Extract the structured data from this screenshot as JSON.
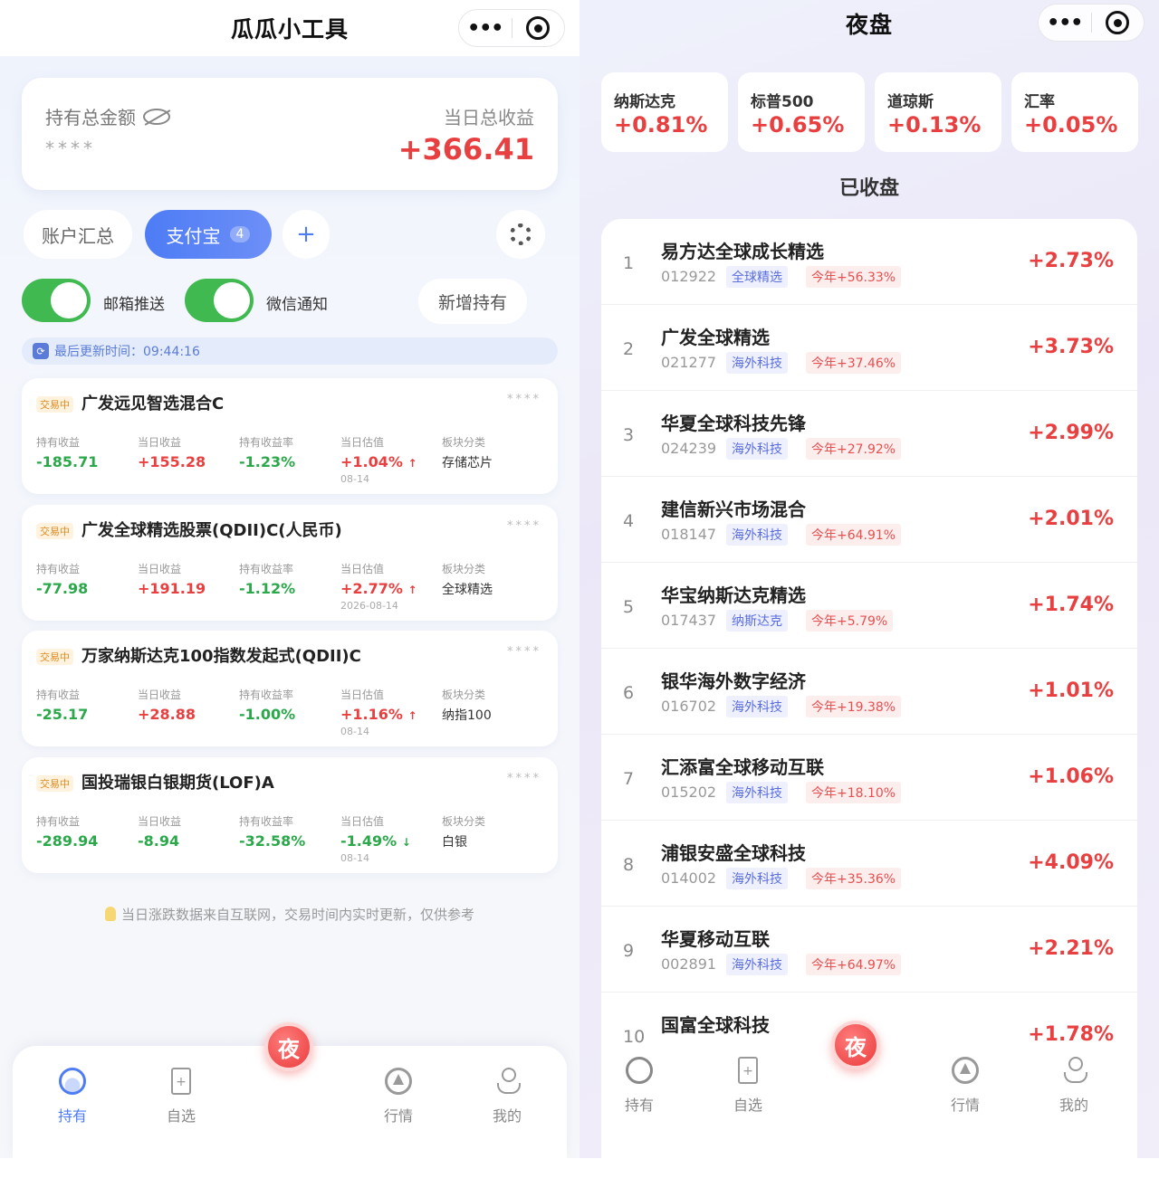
{
  "left": {
    "title": "瓜瓜小工具",
    "summary": {
      "total_label": "持有总金额",
      "total_masked": "****",
      "daily_label": "当日总收益",
      "daily_value": "+366.41"
    },
    "tabs": {
      "account": "账户汇总",
      "alipay": "支付宝",
      "alipay_count": "4",
      "add": "+"
    },
    "toggles": {
      "email": "邮箱推送",
      "wechat": "微信通知",
      "email_on": true,
      "wechat_on": true
    },
    "new_holding": "新增持有",
    "update_label": "最后更新时间：09:44:16",
    "col_labels": {
      "hold_profit": "持有收益",
      "day_profit": "当日收益",
      "hold_rate": "持有收益率",
      "day_est": "当日估值",
      "sector": "板块分类"
    },
    "funds": [
      {
        "status": "交易中",
        "name": "广发远见智选混合C",
        "masked": "****",
        "hold_profit": "-185.71",
        "day_profit": "+155.28",
        "hold_rate": "-1.23%",
        "day_est": "+1.04%",
        "arrow": "↑",
        "date": "08-14",
        "sector": "存储芯片"
      },
      {
        "status": "交易中",
        "name": "广发全球精选股票(QDII)C(人民币)",
        "masked": "****",
        "hold_profit": "-77.98",
        "day_profit": "+191.19",
        "hold_rate": "-1.12%",
        "day_est": "+2.77%",
        "arrow": "↑",
        "date": "2026-08-14",
        "sector": "全球精选"
      },
      {
        "status": "交易中",
        "name": "万家纳斯达克100指数发起式(QDII)C",
        "masked": "****",
        "hold_profit": "-25.17",
        "day_profit": "+28.88",
        "hold_rate": "-1.00%",
        "day_est": "+1.16%",
        "arrow": "↑",
        "date": "08-14",
        "sector": "纳指100"
      },
      {
        "status": "交易中",
        "name": "国投瑞银白银期货(LOF)A",
        "masked": "****",
        "hold_profit": "-289.94",
        "day_profit": "-8.94",
        "hold_rate": "-32.58%",
        "day_est": "-1.49%",
        "arrow": "↓",
        "date": "08-14",
        "sector": "白银"
      }
    ],
    "notice": "当日涨跌数据来自互联网，交易时间内实时更新，仅供参考",
    "nav": {
      "hold": "持有",
      "watch": "自选",
      "night": "夜",
      "market": "行情",
      "me": "我的"
    }
  },
  "right": {
    "title": "夜盘",
    "indices": [
      {
        "name": "纳斯达克",
        "pct": "+0.81%"
      },
      {
        "name": "标普500",
        "pct": "+0.65%"
      },
      {
        "name": "道琼斯",
        "pct": "+0.13%"
      },
      {
        "name": "汇率",
        "pct": "+0.05%"
      }
    ],
    "status": "已收盘",
    "funds": [
      {
        "rank": "1",
        "name": "易方达全球成长精选",
        "code": "012922",
        "tag": "全球精选",
        "ytd": "今年+56.33%",
        "pct": "+2.73%"
      },
      {
        "rank": "2",
        "name": "广发全球精选",
        "code": "021277",
        "tag": "海外科技",
        "ytd": "今年+37.46%",
        "pct": "+3.73%"
      },
      {
        "rank": "3",
        "name": "华夏全球科技先锋",
        "code": "024239",
        "tag": "海外科技",
        "ytd": "今年+27.92%",
        "pct": "+2.99%"
      },
      {
        "rank": "4",
        "name": "建信新兴市场混合",
        "code": "018147",
        "tag": "海外科技",
        "ytd": "今年+64.91%",
        "pct": "+2.01%"
      },
      {
        "rank": "5",
        "name": "华宝纳斯达克精选",
        "code": "017437",
        "tag": "纳斯达克",
        "ytd": "今年+5.79%",
        "pct": "+1.74%"
      },
      {
        "rank": "6",
        "name": "银华海外数字经济",
        "code": "016702",
        "tag": "海外科技",
        "ytd": "今年+19.38%",
        "pct": "+1.01%"
      },
      {
        "rank": "7",
        "name": "汇添富全球移动互联",
        "code": "015202",
        "tag": "海外科技",
        "ytd": "今年+18.10%",
        "pct": "+1.06%"
      },
      {
        "rank": "8",
        "name": "浦银安盛全球科技",
        "code": "014002",
        "tag": "海外科技",
        "ytd": "今年+35.36%",
        "pct": "+4.09%"
      },
      {
        "rank": "9",
        "name": "华夏移动互联",
        "code": "002891",
        "tag": "海外科技",
        "ytd": "今年+64.97%",
        "pct": "+2.21%"
      },
      {
        "rank": "10",
        "name": "国富全球科技",
        "code": "",
        "tag": "",
        "ytd": "",
        "pct": "+1.78%"
      }
    ],
    "nav": {
      "hold": "持有",
      "watch": "自选",
      "night": "夜",
      "market": "行情",
      "me": "我的"
    }
  },
  "colors": {
    "up": "#e84040",
    "down": "#2aa84a",
    "accent": "#4d7cf5",
    "switch_on": "#3fb950"
  }
}
